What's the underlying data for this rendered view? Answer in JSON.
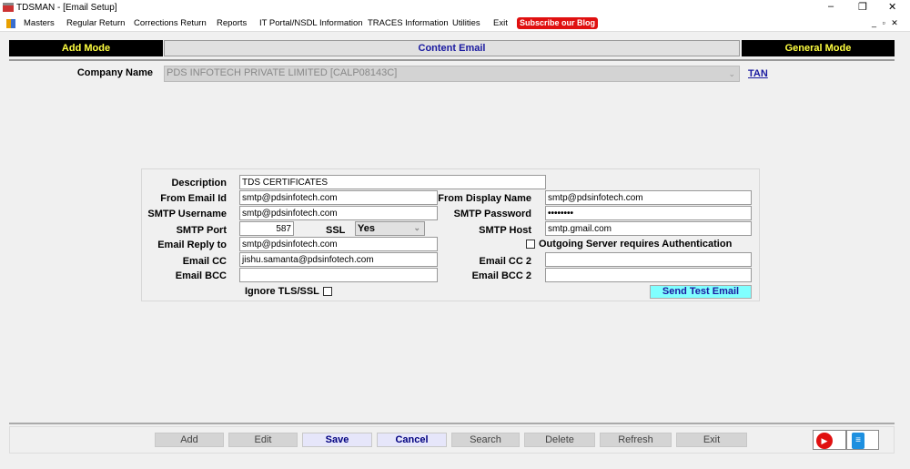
{
  "window": {
    "title": "TDSMAN - [Email Setup]",
    "minimize": "–",
    "restore": "❐",
    "close": "✕",
    "mdi_controls": "_ ▫ ✕"
  },
  "menu": [
    "Masters",
    "Regular Return",
    "Corrections Return",
    "Reports",
    "IT Portal/NSDL Information",
    "TRACES Information",
    "Utilities",
    "Exit"
  ],
  "blog_button": "Subscribe our Blog",
  "modes": {
    "left": "Add Mode",
    "center": "Content Email",
    "right": "General Mode"
  },
  "company": {
    "label": "Company Name",
    "value": "PDS INFOTECH PRIVATE LIMITED [CALP08143C]",
    "tan_link": "TAN"
  },
  "form": {
    "description": {
      "label": "Description",
      "value": "TDS CERTIFICATES"
    },
    "from_email": {
      "label": "From Email Id",
      "value": "smtp@pdsinfotech.com"
    },
    "from_display": {
      "label": "From Display Name",
      "value": "smtp@pdsinfotech.com"
    },
    "smtp_user": {
      "label": "SMTP Username",
      "value": "smtp@pdsinfotech.com"
    },
    "smtp_pass": {
      "label": "SMTP Password",
      "value": "••••••••"
    },
    "smtp_port": {
      "label": "SMTP Port",
      "value": "587"
    },
    "ssl": {
      "label": "SSL",
      "value": "Yes"
    },
    "smtp_host": {
      "label": "SMTP Host",
      "value": "smtp.gmail.com"
    },
    "reply_to": {
      "label": "Email Reply to",
      "value": "smtp@pdsinfotech.com"
    },
    "auth": {
      "label": "Outgoing Server requires Authentication",
      "checked": false
    },
    "cc": {
      "label": "Email CC",
      "value": "jishu.samanta@pdsinfotech.com"
    },
    "cc2": {
      "label": "Email CC 2",
      "value": ""
    },
    "bcc": {
      "label": "Email BCC",
      "value": ""
    },
    "bcc2": {
      "label": "Email BCC 2",
      "value": ""
    },
    "ignore_tls": {
      "label": "Ignore TLS/SSL",
      "checked": false
    },
    "send_test": "Send Test Email"
  },
  "buttons": [
    "Add",
    "Edit",
    "Save",
    "Cancel",
    "Search",
    "Delete",
    "Refresh",
    "Exit"
  ]
}
